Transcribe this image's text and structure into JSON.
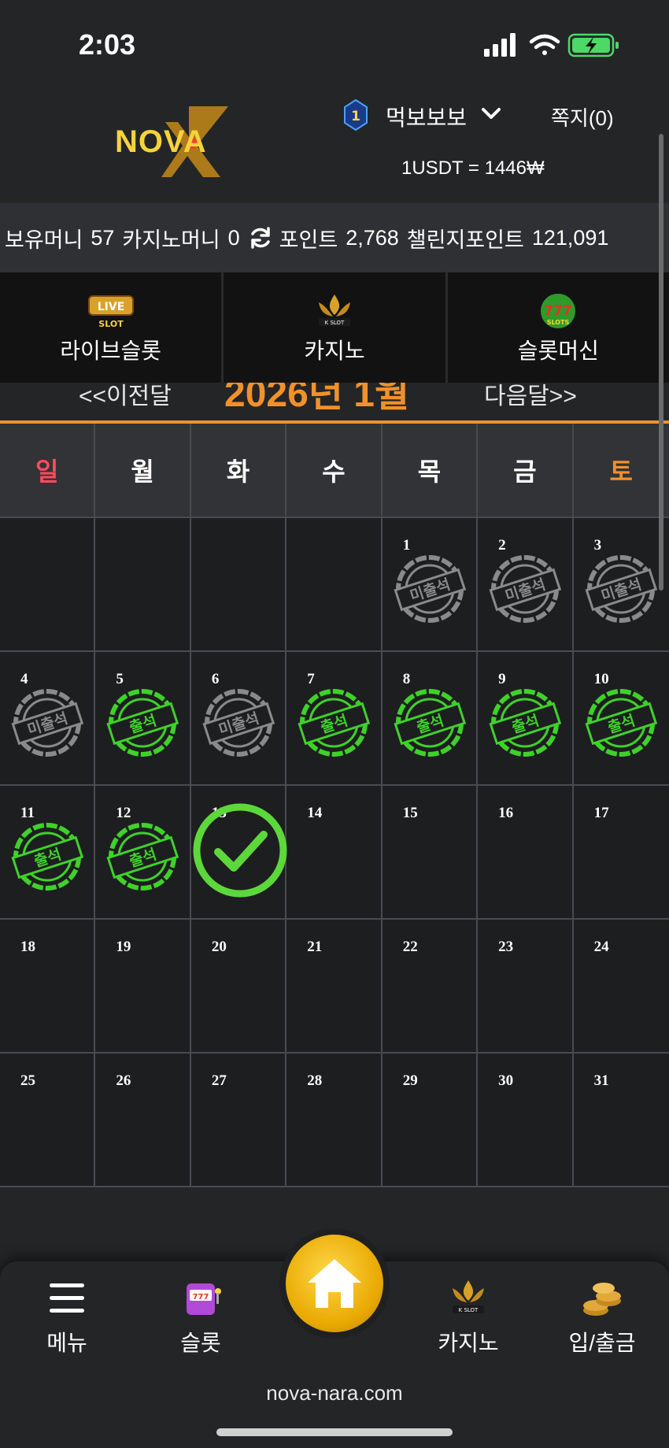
{
  "status": {
    "time": "2:03"
  },
  "header": {
    "logo_text": "NOVA",
    "rank": "1",
    "username": "먹보보보",
    "messages": "쪽지(0)",
    "rate": "1USDT = 1446₩"
  },
  "balance": {
    "money_label": "보유머니",
    "money": "57",
    "casino_label": "카지노머니",
    "casino": "0",
    "points_label": "포인트",
    "points": "2,768",
    "challenge_label": "챌린지포인트",
    "challenge": "121,091"
  },
  "categories": [
    {
      "label": "라이브슬롯",
      "icon": "live-slot-icon"
    },
    {
      "label": "카지노",
      "icon": "k-slot-icon"
    },
    {
      "label": "슬롯머신",
      "icon": "777-slots-icon"
    }
  ],
  "month_nav": {
    "prev": "<<이전달",
    "current": "2026년 1월",
    "next": "다음달>>"
  },
  "calendar": {
    "weekdays": [
      "일",
      "월",
      "화",
      "수",
      "목",
      "금",
      "토"
    ],
    "present_label": "출석",
    "absent_label": "미출석"
  },
  "bottom_nav": {
    "menu": "메뉴",
    "slot": "슬롯",
    "casino": "카지노",
    "deposit": "입/출금",
    "url": "nova-nara.com"
  },
  "colors": {
    "accent": "#f0912b",
    "present": "#3fd12a",
    "absent": "#8a8a8a",
    "sunday": "#ff4b5e",
    "saturday": "#f0912b"
  }
}
